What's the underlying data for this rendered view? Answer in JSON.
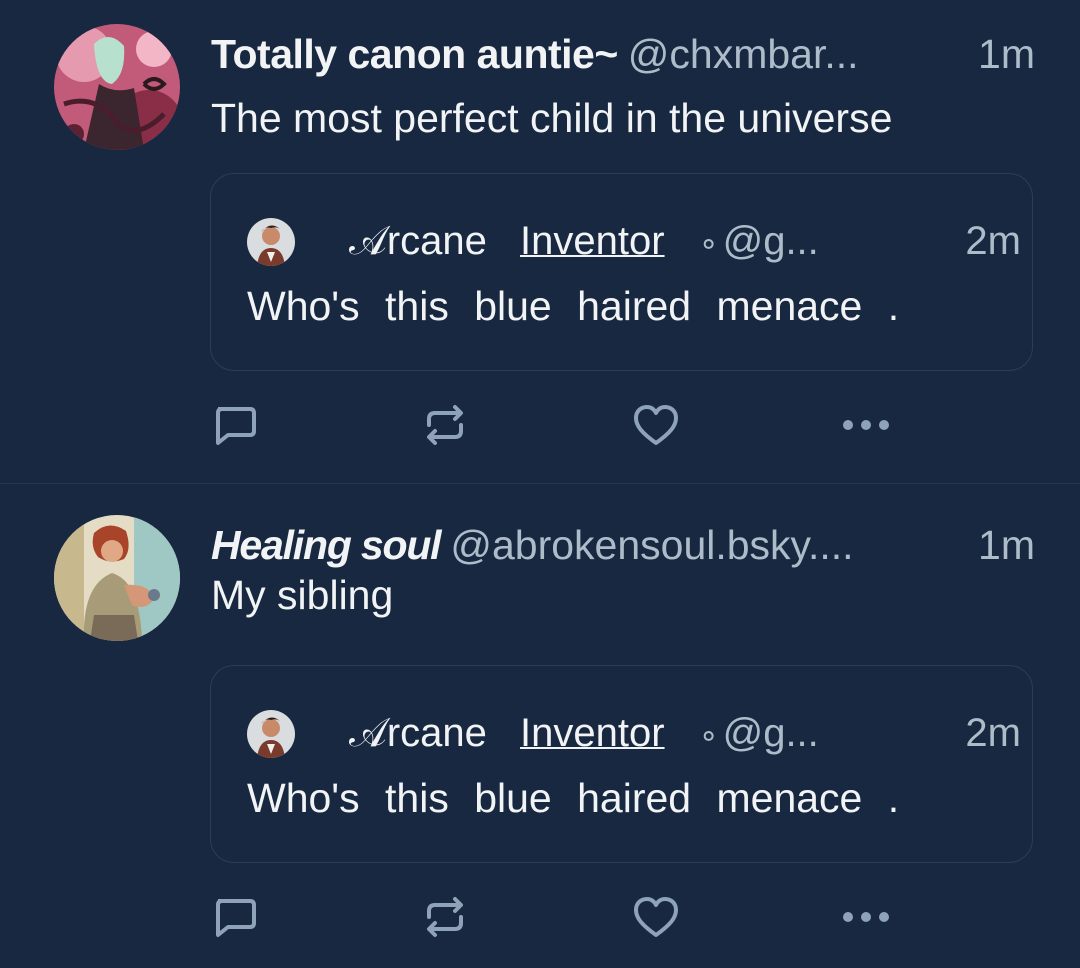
{
  "posts": [
    {
      "author": {
        "display_name": "Totally canon auntie~",
        "handle": "@chxmbar...",
        "avatar_icon": "profile-avatar-pink-artwork"
      },
      "time": "1m",
      "text": "The most perfect child in the universe",
      "quote": {
        "author": {
          "display_name_prefix": "𝒜rcane",
          "display_name_suffix": "Inventor",
          "separator": "∘",
          "handle": "@g...",
          "avatar_icon": "profile-avatar-small"
        },
        "time": "2m",
        "text": "Who's this blue haired menace ."
      },
      "actions": [
        "reply-icon",
        "repost-icon",
        "like-icon",
        "more-icon"
      ]
    },
    {
      "author": {
        "display_name": "Healing soul",
        "handle": "@abrokensoul.bsky....",
        "avatar_icon": "profile-avatar-illustration"
      },
      "time": "1m",
      "text": "My sibling",
      "quote": {
        "author": {
          "display_name_prefix": "𝒜rcane",
          "display_name_suffix": "Inventor",
          "separator": "∘",
          "handle": "@g...",
          "avatar_icon": "profile-avatar-small"
        },
        "time": "2m",
        "text": "Who's this blue haired menace ."
      },
      "actions": [
        "reply-icon",
        "repost-icon",
        "like-icon",
        "more-icon"
      ]
    }
  ],
  "colors": {
    "background": "#172840",
    "primary_text": "#f1f3f5",
    "secondary_text": "#aebbc9",
    "icon": "#8fa3b8",
    "border": "#2c3e56"
  }
}
